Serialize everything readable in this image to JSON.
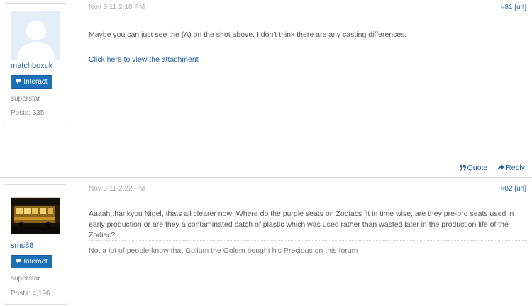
{
  "posts": [
    {
      "username": "matchboxuk",
      "interact_label": "Interact",
      "rank": "superstar",
      "posts_count": "Posts: 335",
      "timestamp": "Nov 3 11 2:18 PM",
      "post_number": "81",
      "url_label": "[url]",
      "body": "Maybe you can just see the (A) on the shot above.  I don't think there are any casting differences.",
      "attachment_link": "Click here to view the attachment",
      "quote_label": "Quote",
      "reply_label": "Reply"
    },
    {
      "username": "sms88",
      "interact_label": "Interact",
      "rank": "superstar",
      "posts_count": "Posts: 4,196",
      "timestamp": "Nov 3 11 2:22 PM",
      "post_number": "82",
      "url_label": "[url]",
      "body": "Aaaah,thankyou Nigel, thats all clearer now! Where do the purple seats on Zodiacs fit in time wise, are they pre-pro seats used in early production or are they a contaminated batch of plastic which was used rather than wasted later in the production life of the Zodiac?",
      "signature": "Not a lot of people know that Gollum the Golem bought his Precious on this forum"
    }
  ],
  "colors": {
    "link": "#1f5f9a",
    "button": "#1d70b8",
    "muted": "#aaaaaa"
  }
}
